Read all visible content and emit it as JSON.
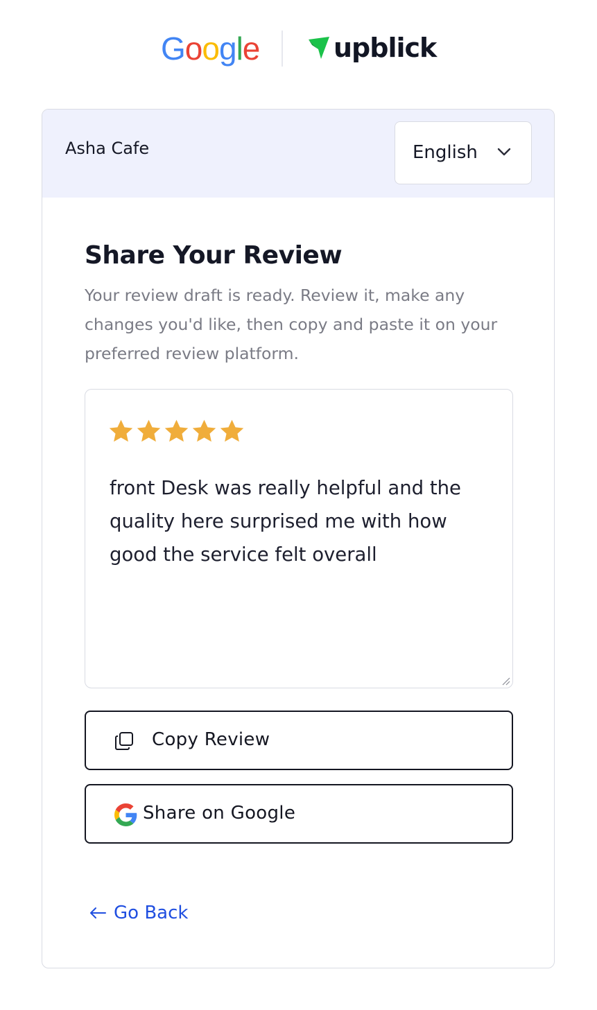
{
  "header": {
    "google_logo_text": "Google",
    "brand_logo_text": "upblick",
    "brand_color": "#1bc24a",
    "google_colors": [
      "#4285F4",
      "#EA4335",
      "#FBBC05",
      "#4285F4",
      "#34A853",
      "#EA4335"
    ]
  },
  "card": {
    "business_name": "Asha Cafe",
    "language": {
      "selected": "English",
      "icon": "chevron-down-icon"
    },
    "title": "Share Your Review",
    "description": "Your review draft is ready. Review it, make any changes you'd like, then copy and paste it on your preferred review platform.",
    "review": {
      "rating": 5,
      "max_rating": 5,
      "star_color": "#f0ad3b",
      "text": "front Desk was really helpful and the quality here surprised me with how good the service felt overall"
    },
    "buttons": {
      "copy_label": "Copy Review",
      "copy_icon": "copy-icon",
      "google_label": "Share on Google",
      "google_icon": "google-g-icon"
    },
    "go_back_label": "Go Back",
    "link_color": "#1f4ee0"
  }
}
